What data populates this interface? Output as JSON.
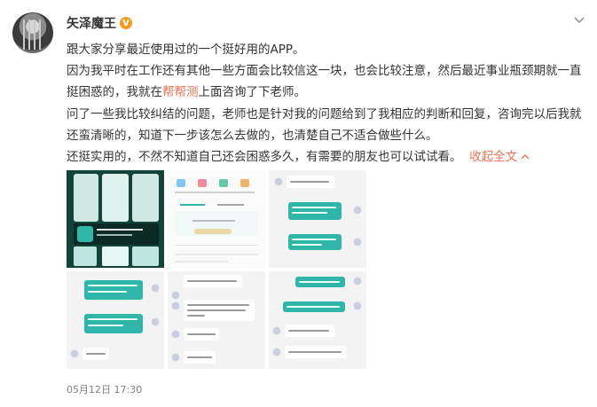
{
  "author": {
    "name": "矢泽魔王",
    "verified_badge": "V"
  },
  "post": {
    "paragraphs": [
      {
        "text": "跟大家分享最近使用过的一个挺好用的APP。"
      },
      {
        "before": "因为我平时在工作还有其他一些方面会比较信这一块，也会比较注意，然后最近事业瓶颈期就一直挺困惑的，我就在",
        "link": "帮帮测",
        "after": "上面咨询了下老师。"
      },
      {
        "text": "问了一些我比较纠结的问题，老师也是针对我的问题给到了我相应的判断和回复，咨询完以后我就还蛮清晰的，知道下一步该怎么去做的，也清楚自己不适合做些什么。"
      },
      {
        "text": "还挺实用的，不然不知道自己还会困惑多久，有需要的朋友也可以试试看。",
        "collapse": "收起全文"
      }
    ]
  },
  "image_grid": {
    "images": [
      {
        "id": "img1",
        "kind": "app-store-screens"
      },
      {
        "id": "img2",
        "kind": "app-home-screen"
      },
      {
        "id": "img3",
        "kind": "chat-screen"
      },
      {
        "id": "img4",
        "kind": "chat-screen"
      },
      {
        "id": "img5",
        "kind": "chat-screen"
      },
      {
        "id": "img6",
        "kind": "chat-screen"
      }
    ]
  },
  "timestamp": "05月12日 17:30",
  "colors": {
    "link": "#eb7350",
    "badge": "#f59a1e",
    "chat_bubble": "#2fb6a8"
  },
  "icons": {
    "more": "chevron-down-icon",
    "collapse": "chevron-up-icon"
  }
}
